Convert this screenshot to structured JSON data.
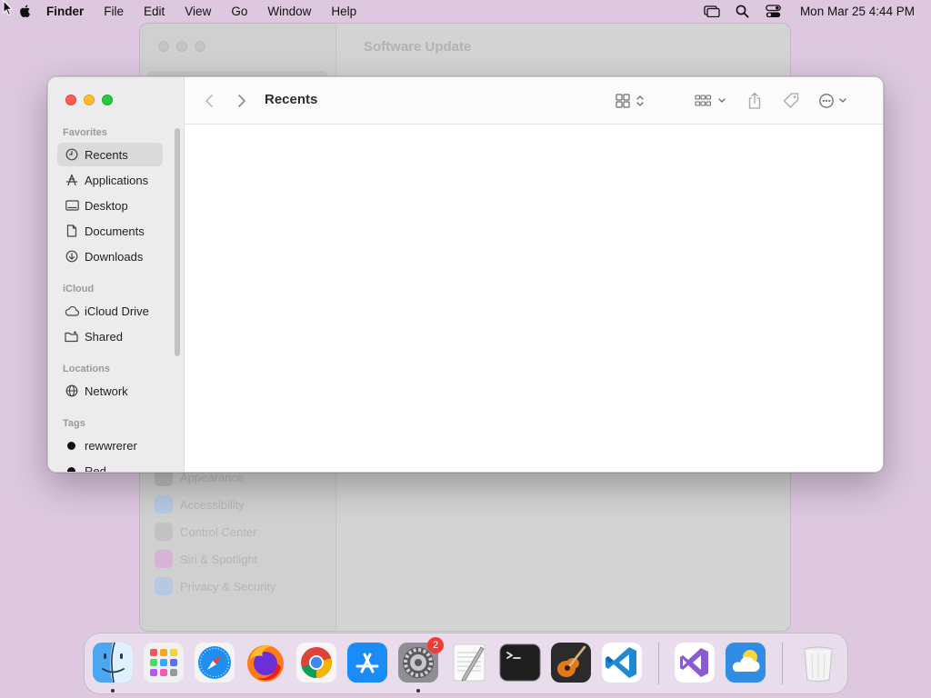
{
  "menubar": {
    "app_name": "Finder",
    "menus": [
      "File",
      "Edit",
      "View",
      "Go",
      "Window",
      "Help"
    ],
    "clock": "Mon Mar 25  4:44 PM"
  },
  "background_window": {
    "title": "Software Update",
    "items": [
      {
        "label": "Appearance",
        "color": "#9a9a9a"
      },
      {
        "label": "Accessibility",
        "color": "#7fa9e0"
      },
      {
        "label": "Control Center",
        "color": "#9a9a9a"
      },
      {
        "label": "Siri & Spotlight",
        "color": "#d67ad0"
      },
      {
        "label": "Privacy & Security",
        "color": "#7fa9e0"
      }
    ]
  },
  "finder": {
    "title": "Recents",
    "sections": {
      "favorites": "Favorites",
      "icloud": "iCloud",
      "locations": "Locations",
      "tags": "Tags"
    },
    "favorites": [
      {
        "label": "Recents",
        "icon": "clock-icon",
        "selected": true
      },
      {
        "label": "Applications",
        "icon": "applications-icon"
      },
      {
        "label": "Desktop",
        "icon": "desktop-icon"
      },
      {
        "label": "Documents",
        "icon": "document-icon"
      },
      {
        "label": "Downloads",
        "icon": "downloads-icon"
      }
    ],
    "icloud": [
      {
        "label": "iCloud Drive",
        "icon": "cloud-icon"
      },
      {
        "label": "Shared",
        "icon": "shared-folder-icon"
      }
    ],
    "locations": [
      {
        "label": "Network",
        "icon": "globe-icon"
      }
    ],
    "tags": [
      {
        "label": "rewwrerer",
        "color": "#111111"
      },
      {
        "label": "Red",
        "color": "#111111"
      }
    ]
  },
  "dock": {
    "apps": [
      {
        "name": "Finder",
        "running": true
      },
      {
        "name": "Launchpad"
      },
      {
        "name": "Safari"
      },
      {
        "name": "Firefox"
      },
      {
        "name": "Chrome"
      },
      {
        "name": "App Store"
      },
      {
        "name": "System Settings",
        "running": true,
        "badge": "2"
      },
      {
        "name": "TextEdit"
      },
      {
        "name": "Terminal"
      },
      {
        "name": "GarageBand"
      },
      {
        "name": "VS Code"
      },
      {
        "name": "Visual Studio"
      },
      {
        "name": "Weather"
      },
      {
        "name": "Trash"
      }
    ]
  }
}
